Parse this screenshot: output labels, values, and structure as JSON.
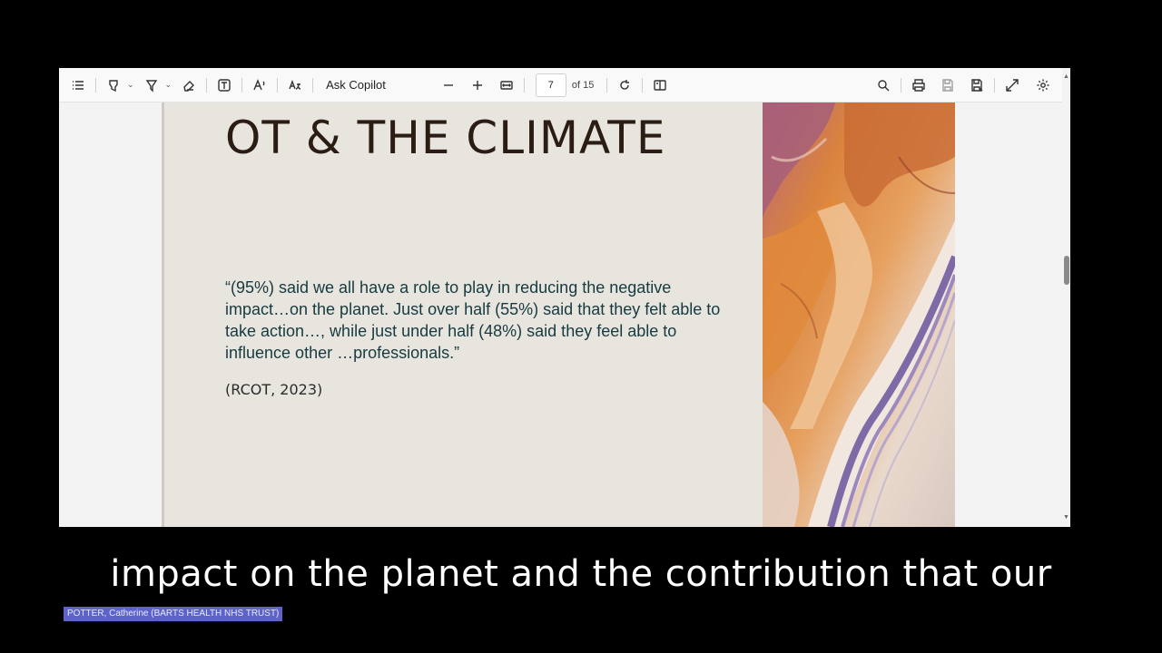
{
  "toolbar": {
    "ask_copilot": "Ask Copilot",
    "page_current": "7",
    "page_total": "of 15",
    "icons": [
      "contents-icon",
      "highlight-icon",
      "draw-icon",
      "erase-icon",
      "text-box-icon",
      "read-aloud-icon",
      "translate-icon",
      "zoom-out-icon",
      "zoom-in-icon",
      "fit-width-icon",
      "rotate-icon",
      "page-view-icon",
      "search-icon",
      "print-icon",
      "save-icon",
      "save-as-icon",
      "fullscreen-icon",
      "settings-icon"
    ]
  },
  "slide": {
    "title": "OT & THE CLIMATE",
    "quote": "“(95%) said we all have a role to play in reducing the negative impact…on the planet. Just over half (55%) said that they felt able to take action…, while just under half (48%) said they feel able to influence other …professionals.”",
    "citation": "(RCOT, 2023)"
  },
  "caption": "impact on the planet and the contribution that our",
  "speaker": "POTTER, Catherine (BARTS HEALTH NHS TRUST)",
  "colors": {
    "accent_speaker": "#5d63c9",
    "slide_bg": "#e8e5df",
    "title_color": "#2b1d14",
    "quote_color": "#173a40"
  }
}
